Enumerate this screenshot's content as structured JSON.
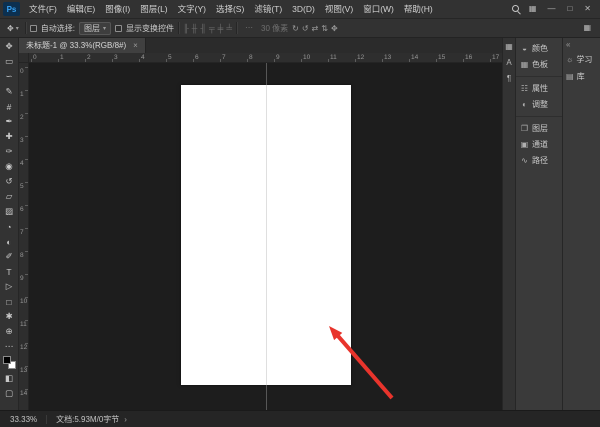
{
  "theme": {
    "accent_blue": "#2d9bf5",
    "logo_bg": "#0c3050",
    "logo_text": "#37a3f5"
  },
  "titlebar": {
    "logo": "Ps"
  },
  "menubar": {
    "items": [
      "文件(F)",
      "编辑(E)",
      "图像(I)",
      "图层(L)",
      "文字(Y)",
      "选择(S)",
      "滤镜(T)",
      "3D(D)",
      "视图(V)",
      "窗口(W)",
      "帮助(H)"
    ],
    "workspace_glyph": "▦",
    "minimize_glyph": "—",
    "maximize_glyph": "□",
    "close_glyph": "✕"
  },
  "optionsbar": {
    "tool_glyph": "✥",
    "caret_glyph": "▾",
    "auto_select_label": "自动选择:",
    "auto_select_value": "图层",
    "show_transform_label": "显示变换控件",
    "align_icons": [
      {
        "name": "align-left-edges-icon",
        "glyph": "╟"
      },
      {
        "name": "align-horizontal-centers-icon",
        "glyph": "╫"
      },
      {
        "name": "align-right-edges-icon",
        "glyph": "╢"
      },
      {
        "name": "align-top-edges-icon",
        "glyph": "╤"
      },
      {
        "name": "align-vertical-centers-icon",
        "glyph": "╪"
      },
      {
        "name": "align-bottom-edges-icon",
        "glyph": "╧"
      }
    ],
    "more_glyph": "⋯",
    "px_label": "30 像素",
    "mode_icons": [
      {
        "name": "3d-rotate-icon",
        "glyph": "↻"
      },
      {
        "name": "3d-roll-icon",
        "glyph": "↺"
      },
      {
        "name": "3d-drag-icon",
        "glyph": "⇄"
      },
      {
        "name": "3d-slide-icon",
        "glyph": "⇅"
      },
      {
        "name": "3d-scale-icon",
        "glyph": "✥"
      }
    ],
    "workspace_glyph": "▦"
  },
  "tab": {
    "title": "未标题-1 @ 33.3%(RGB/8#)",
    "close_glyph": "×"
  },
  "rulers": {
    "horizontal": [
      "0",
      "1",
      "2",
      "3",
      "4",
      "5",
      "6",
      "7",
      "8",
      "9",
      "10",
      "11",
      "12",
      "13",
      "14",
      "15",
      "16",
      "17"
    ],
    "vertical": [
      "0",
      "1",
      "2",
      "3",
      "4",
      "5",
      "6",
      "7",
      "8",
      "9",
      "10",
      "11",
      "12",
      "13",
      "14"
    ]
  },
  "toolbar": {
    "tools": [
      {
        "name": "move-tool",
        "glyph": "✥"
      },
      {
        "name": "marquee-tool",
        "glyph": "▭"
      },
      {
        "name": "lasso-tool",
        "glyph": "∽"
      },
      {
        "name": "quick-selection-tool",
        "glyph": "✎"
      },
      {
        "name": "crop-tool",
        "glyph": "#"
      },
      {
        "name": "eyedropper-tool",
        "glyph": "✒"
      },
      {
        "name": "healing-brush-tool",
        "glyph": "✚"
      },
      {
        "name": "brush-tool",
        "glyph": "✑"
      },
      {
        "name": "clone-stamp-tool",
        "glyph": "◉"
      },
      {
        "name": "history-brush-tool",
        "glyph": "↺"
      },
      {
        "name": "eraser-tool",
        "glyph": "▱"
      },
      {
        "name": "gradient-tool",
        "glyph": "▨"
      },
      {
        "name": "blur-tool",
        "glyph": "◔"
      },
      {
        "name": "dodge-tool",
        "glyph": "◐"
      },
      {
        "name": "pen-tool",
        "glyph": "✐"
      },
      {
        "name": "type-tool",
        "glyph": "T"
      },
      {
        "name": "path-selection-tool",
        "glyph": "▷"
      },
      {
        "name": "shape-tool",
        "glyph": "□"
      },
      {
        "name": "hand-tool",
        "glyph": "✱"
      },
      {
        "name": "zoom-tool",
        "glyph": "⊕"
      }
    ],
    "more_glyph": "⋯",
    "foreground_color": "#000000",
    "background_color": "#ffffff",
    "quick_mask_glyph": "◧",
    "screen_mode_glyph": "▢"
  },
  "canvas": {
    "document_background": "#ffffff",
    "guide_color": "rgba(175,175,175,0.40)",
    "arrow_color": "#e8342c"
  },
  "right_dock": {
    "narrow_icons": [
      {
        "name": "grid-panel-icon",
        "glyph": "▦"
      },
      {
        "name": "character-panel-icon",
        "glyph": "A"
      },
      {
        "name": "paragraph-panel-icon",
        "glyph": "¶"
      }
    ],
    "groups": [
      {
        "items": [
          {
            "name": "color-panel",
            "label": "颜色",
            "glyph": "◒"
          },
          {
            "name": "swatches-panel",
            "label": "色板",
            "glyph": "▦"
          }
        ]
      },
      {
        "items": [
          {
            "name": "properties-panel",
            "label": "属性",
            "glyph": "☷"
          },
          {
            "name": "adjustments-panel",
            "label": "调整",
            "glyph": "◐"
          }
        ]
      },
      {
        "items": [
          {
            "name": "layers-panel",
            "label": "图层",
            "glyph": "❐"
          },
          {
            "name": "channels-panel",
            "label": "通道",
            "glyph": "▣"
          },
          {
            "name": "paths-panel",
            "label": "路径",
            "glyph": "∿"
          }
        ]
      }
    ],
    "far_right": {
      "collapse_glyph": "«",
      "items": [
        {
          "name": "learn-panel",
          "label": "学习",
          "glyph": "☼"
        },
        {
          "name": "libraries-panel",
          "label": "库",
          "glyph": "▤"
        }
      ]
    }
  },
  "statusbar": {
    "zoom": "33.33%",
    "doc_info": "文档:5.93M/0字节",
    "expand_glyph": "›"
  }
}
